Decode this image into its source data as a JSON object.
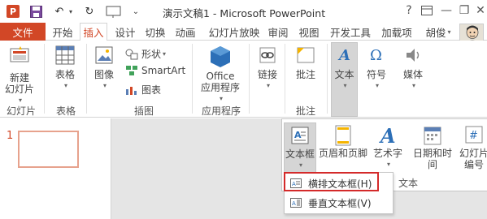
{
  "window": {
    "title": "演示文稿1 - Microsoft PowerPoint",
    "help": "?",
    "minimize": "—",
    "restore": "❐",
    "close": "✕"
  },
  "tabs": {
    "file": "文件",
    "items": [
      "开始",
      "插入",
      "设计",
      "切换",
      "动画",
      "幻灯片放映",
      "审阅",
      "视图",
      "开发工具",
      "加载项",
      "胡俊"
    ],
    "active": "插入"
  },
  "ribbon": {
    "new_slide": "新建\n幻灯片",
    "table": "表格",
    "image": "图像",
    "shapes": "形状",
    "smartart": "SmartArt",
    "chart": "图表",
    "office_apps": "Office\n应用程序",
    "link": "链接",
    "comment": "批注",
    "text": "文本",
    "symbol": "符号",
    "media": "媒体",
    "group_labels": {
      "slides": "幻灯片",
      "tables": "表格",
      "illustrations": "插图",
      "apps": "应用程序",
      "comments": "批注"
    }
  },
  "slides_pane": {
    "slide_number": "1"
  },
  "text_panel": {
    "textbox": "文本框",
    "header_footer": "页眉和页脚",
    "wordart": "艺术字",
    "date_time": "日期和时间",
    "slide_number": "幻灯片\n编号",
    "group_label": "文本"
  },
  "textbox_menu": {
    "horizontal": "横排文本框(H)",
    "vertical": "垂直文本框(V)"
  },
  "colors": {
    "accent": "#d24726",
    "highlight_box": "#d42a2a",
    "selected_bg": "#d5d5d5",
    "canvas_bg": "#e5e5e5"
  }
}
